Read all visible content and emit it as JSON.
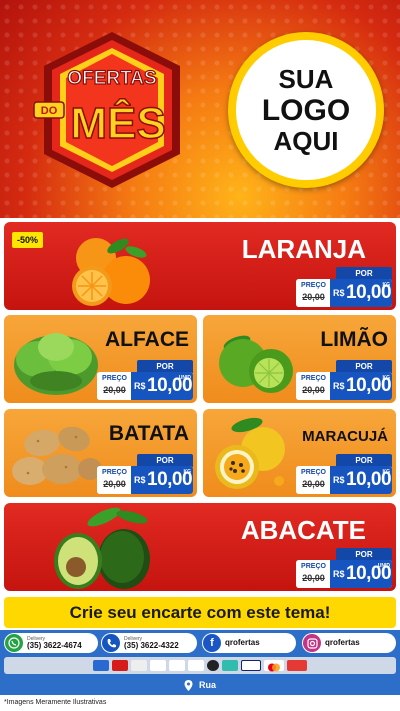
{
  "header": {
    "badge_line1": "OFERTAS",
    "badge_line2": "DO",
    "badge_line3": "MÊS",
    "logo_line1": "SUA",
    "logo_line2": "LOGO",
    "logo_line3": "AQUI"
  },
  "products": [
    {
      "name": "LARANJA",
      "badge": "-50%",
      "preco_label": "PREÇO",
      "por_label": "POR",
      "old_price": "20,00",
      "currency": "R$",
      "price": "10,00",
      "unit": "KG",
      "image": "orange-fruit"
    },
    {
      "name": "ALFACE",
      "preco_label": "PREÇO",
      "por_label": "POR",
      "old_price": "20,00",
      "currency": "R$",
      "price": "10,00",
      "unit": "UNID",
      "image": "lettuce"
    },
    {
      "name": "LIMÃO",
      "preco_label": "PREÇO",
      "por_label": "POR",
      "old_price": "20,00",
      "currency": "R$",
      "price": "10,00",
      "unit": "KG",
      "image": "lime"
    },
    {
      "name": "BATATA",
      "preco_label": "PREÇO",
      "por_label": "POR",
      "old_price": "20,00",
      "currency": "R$",
      "price": "10,00",
      "unit": "KG",
      "image": "potato"
    },
    {
      "name": "MARACUJÁ",
      "preco_label": "PREÇO",
      "por_label": "POR",
      "old_price": "20,00",
      "currency": "R$",
      "price": "10,00",
      "unit": "KG",
      "image": "passion-fruit"
    },
    {
      "name": "ABACATE",
      "preco_label": "PREÇO",
      "por_label": "POR",
      "old_price": "20,00",
      "currency": "R$",
      "price": "10,00",
      "unit": "UNID",
      "image": "avocado"
    }
  ],
  "cta": "Crie seu encarte com este tema!",
  "contacts": {
    "whatsapp_label": "Delivery",
    "whatsapp_number": "(35) 3622-4674",
    "phone_label": "Delivery",
    "phone_number": "(35) 3622-4322",
    "facebook": "qrofertas",
    "instagram": "qrofertas"
  },
  "address": "Rua",
  "footnote": "*Imagens Meramente Ilustrativas",
  "colors": {
    "red": "#d42a10",
    "orange": "#f39527",
    "blue": "#1654c0",
    "yellow": "#ffd800"
  }
}
